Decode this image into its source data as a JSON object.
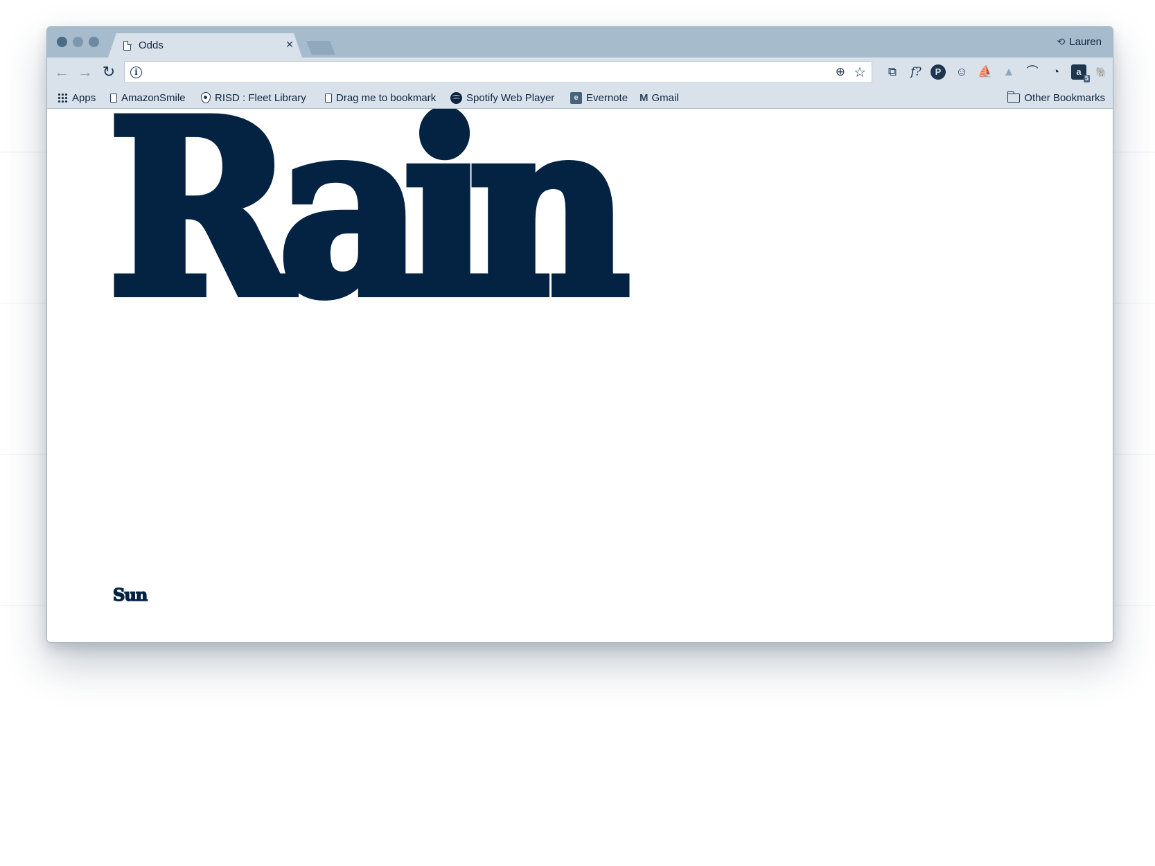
{
  "browser": {
    "tab": {
      "title": "Odds",
      "close_glyph": "×"
    },
    "profile": {
      "name": "Lauren",
      "icon": "sync-icon"
    },
    "toolbar": {
      "back_icon": "←",
      "forward_icon": "→",
      "reload_icon": "↻",
      "url_value": "",
      "info_glyph": "i",
      "zoom_icon": "⊕",
      "star_icon": "☆"
    },
    "extensions": [
      {
        "name": "cast-icon",
        "glyph": "⧉"
      },
      {
        "name": "font-finder-icon",
        "glyph": "f?"
      },
      {
        "name": "pinterest-icon",
        "glyph": "P"
      },
      {
        "name": "owl-icon",
        "glyph": "☺"
      },
      {
        "name": "boat-icon",
        "glyph": "⛵"
      },
      {
        "name": "drive-icon",
        "glyph": "▲"
      },
      {
        "name": "swoosh-icon",
        "glyph": "⌒"
      },
      {
        "name": "clock-icon",
        "glyph": "◔"
      },
      {
        "name": "amazon-assistant-icon",
        "glyph": "a",
        "badge": "5"
      },
      {
        "name": "evernote-extension-icon",
        "glyph": "🐘"
      },
      {
        "name": "screenshot-icon",
        "glyph": "▣"
      },
      {
        "name": "menu-kebab-icon",
        "glyph": "⋮"
      }
    ],
    "bookmarks": {
      "apps": "Apps",
      "items": [
        {
          "label": "AmazonSmile",
          "icon": "page-icon"
        },
        {
          "label": "RISD : Fleet Library",
          "icon": "risd-icon"
        },
        {
          "label": "Drag me to bookmark",
          "icon": "page-icon"
        },
        {
          "label": "Spotify Web Player",
          "icon": "spotify-icon"
        },
        {
          "label": "Evernote",
          "icon": "evernote-icon"
        },
        {
          "label": "Gmail",
          "icon": "gmail-icon"
        }
      ],
      "other": "Other Bookmarks"
    }
  },
  "page": {
    "headline": "Rain",
    "subword": "Sun"
  },
  "colors": {
    "ink": "#042242",
    "chrome": "#d9e2ea",
    "tabstrip": "#a6bccd"
  }
}
